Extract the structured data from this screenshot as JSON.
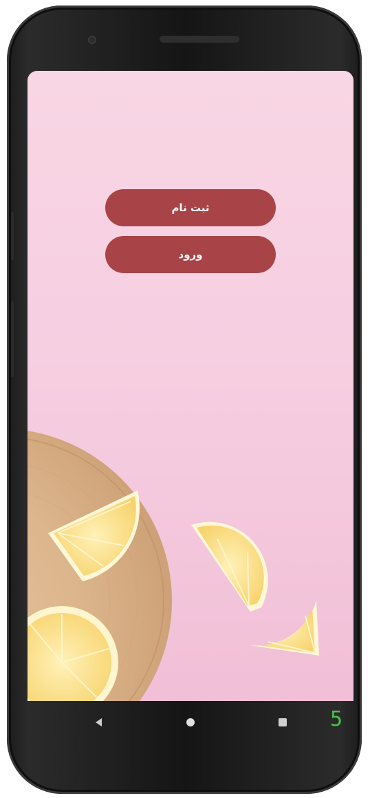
{
  "app": {
    "buttons": {
      "signup_label": "ثبت نام",
      "login_label": "ورود"
    }
  },
  "nav": {
    "back_icon": "back-triangle-icon",
    "home_icon": "home-circle-icon",
    "recents_icon": "recents-square-icon",
    "badge_text": "5"
  },
  "colors": {
    "button_fill": "#a84448",
    "button_text": "#ffffff",
    "background_pink": "#f6cfe1",
    "badge_green": "#49c24a"
  }
}
